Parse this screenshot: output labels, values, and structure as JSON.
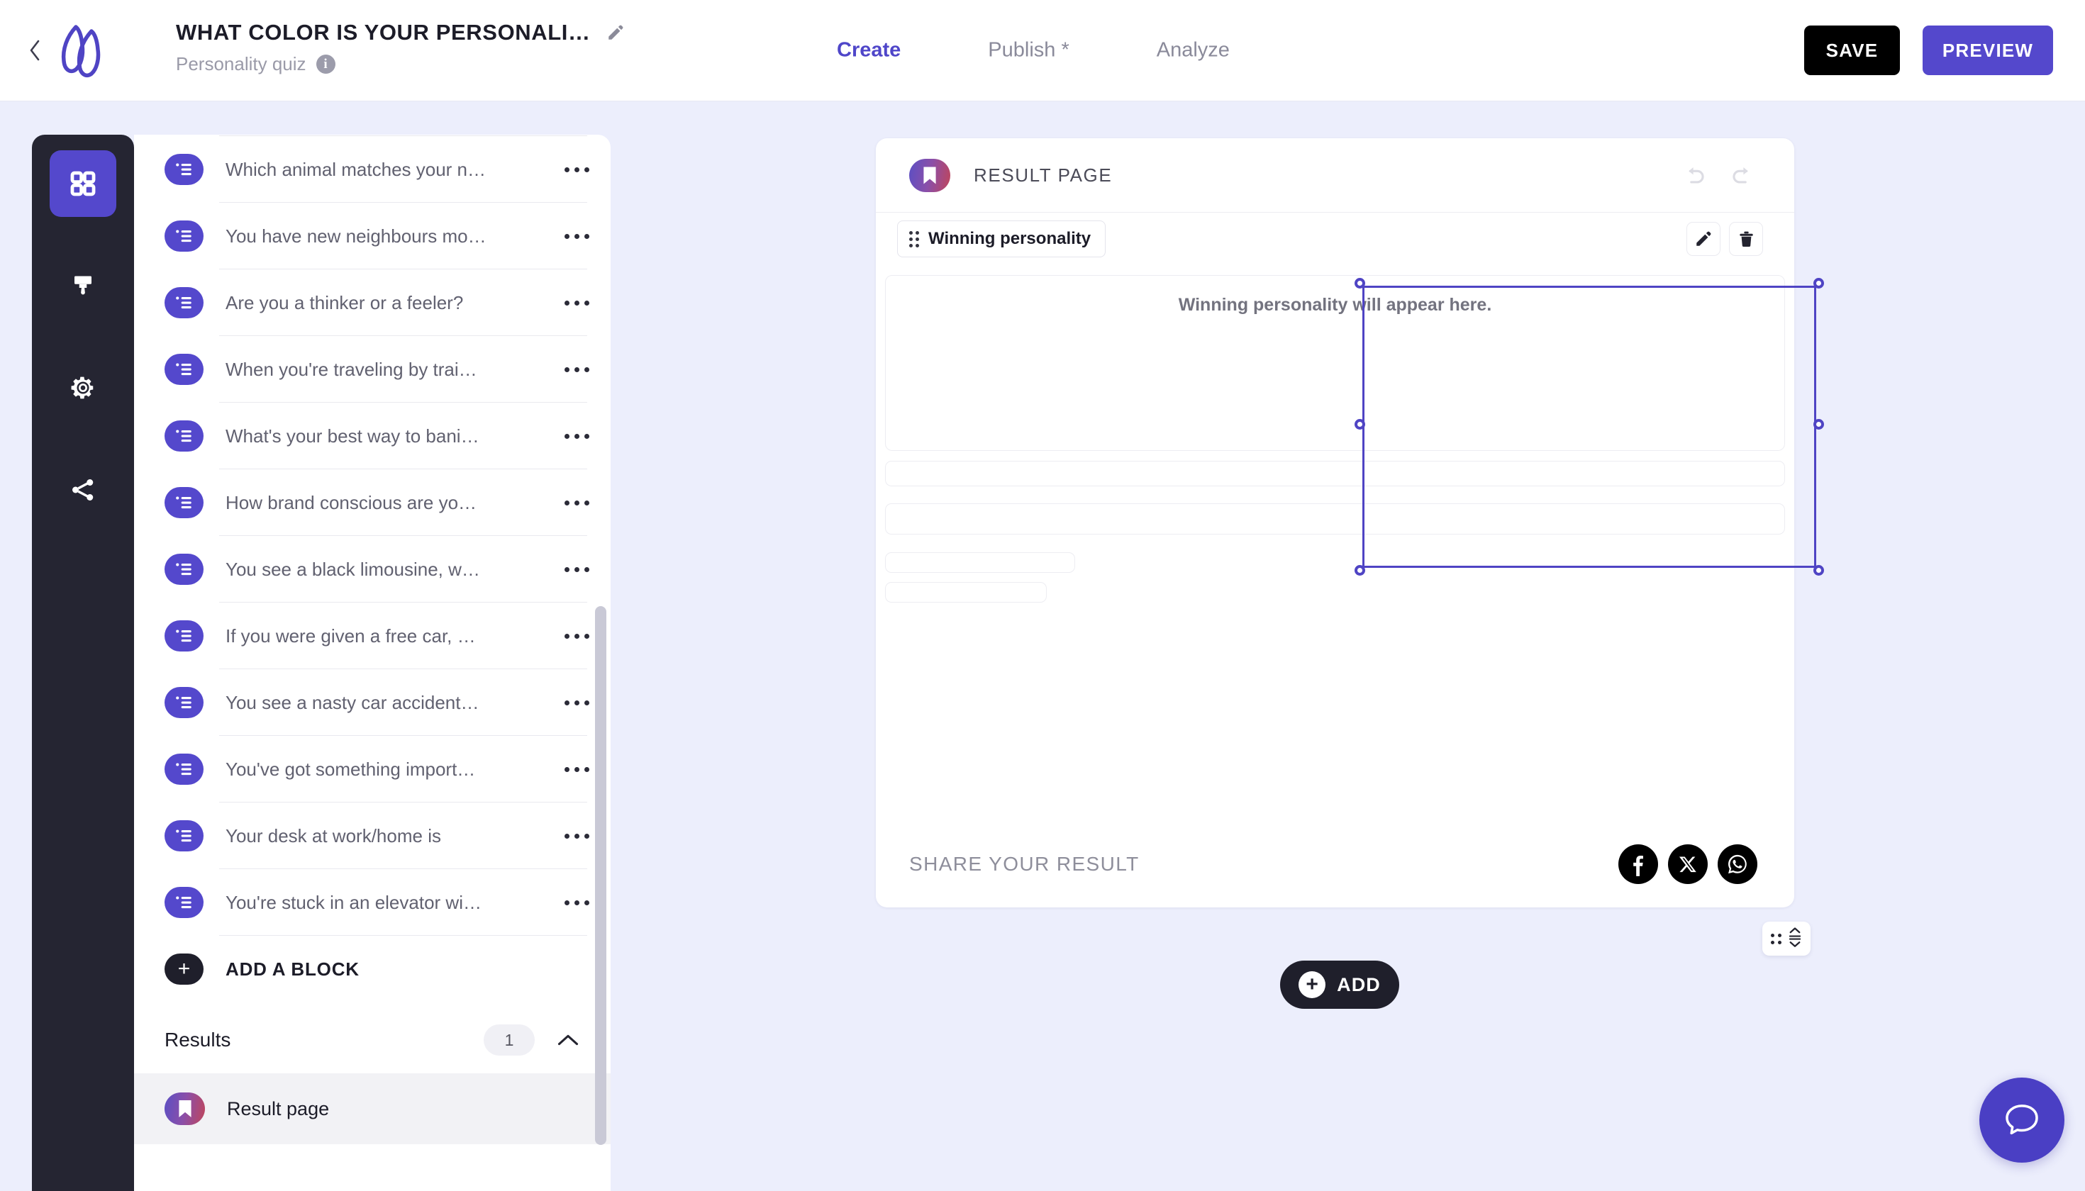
{
  "header": {
    "back_icon": "chevron-left-icon",
    "logo_icon": "brand-logo-icon",
    "quiz_title": "WHAT COLOR IS YOUR PERSONALI…",
    "title_edit_icon": "pencil-icon",
    "quiz_subtitle": "Personality quiz",
    "info_icon": "info-icon",
    "info_glyph": "i",
    "tabs": [
      {
        "label": "Create",
        "active": true
      },
      {
        "label": "Publish *",
        "active": false
      },
      {
        "label": "Analyze",
        "active": false
      }
    ],
    "save_label": "SAVE",
    "preview_label": "PREVIEW",
    "accent_color": "#5448cc",
    "save_color": "#000000"
  },
  "rail": {
    "items": [
      {
        "icon": "grid-blocks-icon",
        "active": true
      },
      {
        "icon": "paintbrush-icon",
        "active": false
      },
      {
        "icon": "gear-icon",
        "active": false
      },
      {
        "icon": "share-nodes-icon",
        "active": false
      }
    ]
  },
  "sidebar": {
    "questions": [
      {
        "label": "Which animal matches your n…",
        "icon": "question-list-icon",
        "menu_icon": "more-dots-icon"
      },
      {
        "label": "You have new neighbours mo…",
        "icon": "question-list-icon",
        "menu_icon": "more-dots-icon"
      },
      {
        "label": "Are you a thinker or a feeler?",
        "icon": "question-list-icon",
        "menu_icon": "more-dots-icon"
      },
      {
        "label": "When you're traveling by trai…",
        "icon": "question-list-icon",
        "menu_icon": "more-dots-icon"
      },
      {
        "label": "What's your best way to bani…",
        "icon": "question-list-icon",
        "menu_icon": "more-dots-icon"
      },
      {
        "label": "How brand conscious are yo…",
        "icon": "question-list-icon",
        "menu_icon": "more-dots-icon"
      },
      {
        "label": "You see a black limousine, w…",
        "icon": "question-list-icon",
        "menu_icon": "more-dots-icon"
      },
      {
        "label": "If you were given a free car, …",
        "icon": "question-list-icon",
        "menu_icon": "more-dots-icon"
      },
      {
        "label": "You see a nasty car accident…",
        "icon": "question-list-icon",
        "menu_icon": "more-dots-icon"
      },
      {
        "label": "You've got something import…",
        "icon": "question-list-icon",
        "menu_icon": "more-dots-icon"
      },
      {
        "label": "Your desk at work/home is",
        "icon": "question-list-icon",
        "menu_icon": "more-dots-icon"
      },
      {
        "label": "You're stuck in an elevator wi…",
        "icon": "question-list-icon",
        "menu_icon": "more-dots-icon"
      }
    ],
    "add_block_label": "ADD A BLOCK",
    "add_block_icon": "plus-icon",
    "results_title": "Results",
    "results_count": "1",
    "results_collapse_icon": "chevron-up-icon",
    "result_page_label": "Result page",
    "result_page_icon": "bookmark-icon"
  },
  "canvas": {
    "page_icon": "bookmark-icon",
    "page_title": "RESULT PAGE",
    "undo_icon": "undo-arrow-icon",
    "redo_icon": "redo-arrow-icon",
    "block": {
      "drag_icon": "drag-handle-icon",
      "chip_label": "Winning personality",
      "edit_icon": "pencil-icon",
      "delete_icon": "trash-icon",
      "placeholder_text": "Winning personality will appear here."
    },
    "share": {
      "label": "SHARE YOUR RESULT",
      "networks": [
        {
          "name": "facebook-icon"
        },
        {
          "name": "x-twitter-icon"
        },
        {
          "name": "whatsapp-icon"
        }
      ]
    },
    "selection_color": "#4f44c4"
  },
  "floating": {
    "reorder_icon": "drag-reorder-icon",
    "add_label": "ADD",
    "add_icon": "plus-circle-icon",
    "chat_icon": "chat-bubble-icon",
    "chat_color": "#4a3fc4"
  }
}
